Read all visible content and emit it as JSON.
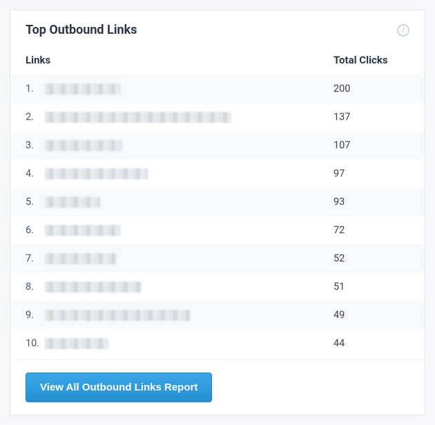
{
  "card": {
    "title": "Top Outbound Links",
    "info_icon": "info-icon"
  },
  "table": {
    "header_links": "Links",
    "header_clicks": "Total Clicks",
    "rows": [
      {
        "index": "1.",
        "link": "████████",
        "blur_width": 110,
        "clicks": "200"
      },
      {
        "index": "2.",
        "link": "████████████████████",
        "blur_width": 270,
        "clicks": "137"
      },
      {
        "index": "3.",
        "link": "████████",
        "blur_width": 112,
        "clicks": "107"
      },
      {
        "index": "4.",
        "link": "██████████",
        "blur_width": 150,
        "clicks": "97"
      },
      {
        "index": "5.",
        "link": "█████",
        "blur_width": 80,
        "clicks": "93"
      },
      {
        "index": "6.",
        "link": "████████",
        "blur_width": 110,
        "clicks": "72"
      },
      {
        "index": "7.",
        "link": "████████",
        "blur_width": 104,
        "clicks": "52"
      },
      {
        "index": "8.",
        "link": "██████████",
        "blur_width": 140,
        "clicks": "51"
      },
      {
        "index": "9.",
        "link": "██████████████",
        "blur_width": 210,
        "clicks": "49"
      },
      {
        "index": "10.",
        "link": "██████",
        "blur_width": 92,
        "clicks": "44"
      }
    ]
  },
  "footer": {
    "button_label": "View All Outbound Links Report"
  }
}
